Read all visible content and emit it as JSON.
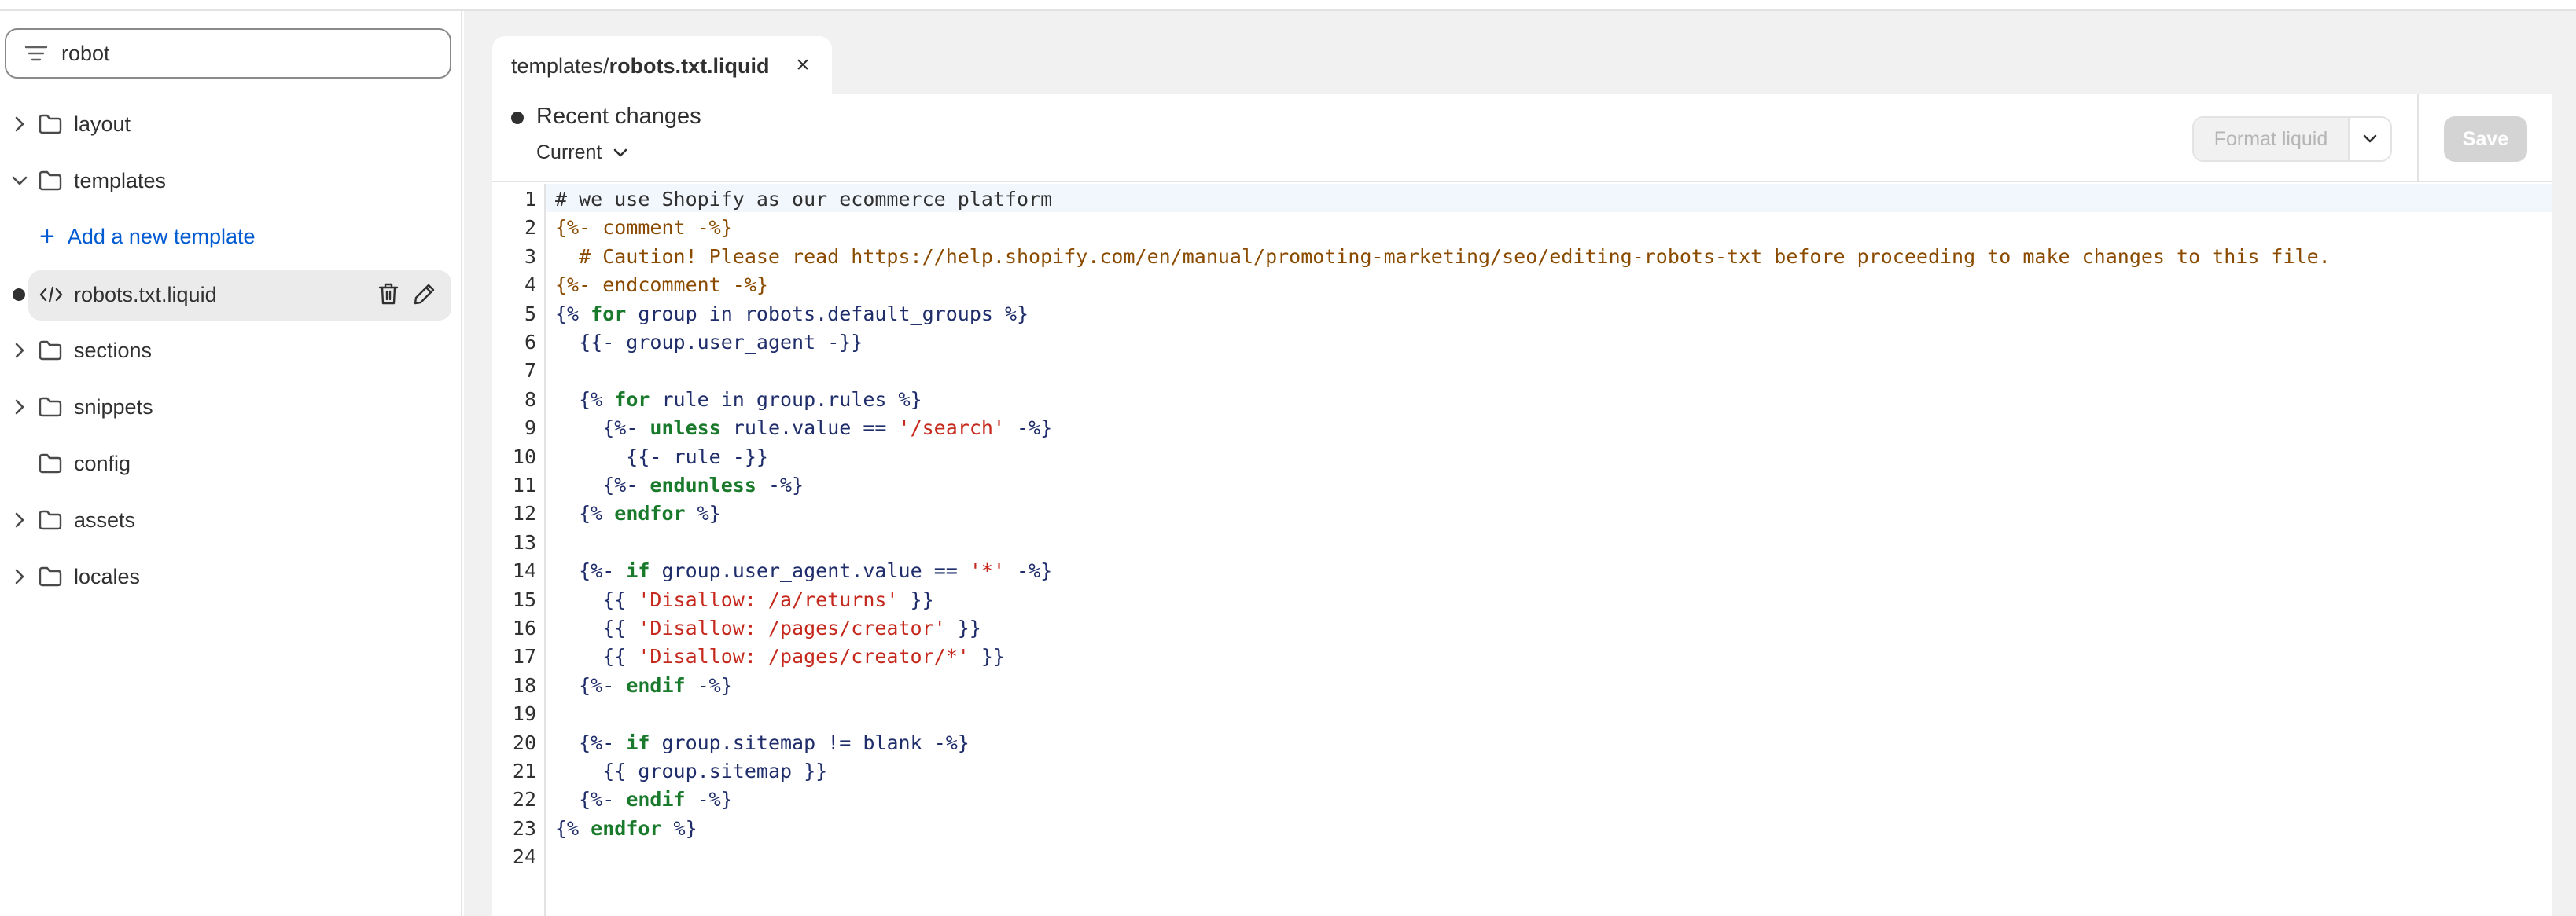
{
  "sidebar": {
    "search_value": "robot",
    "tree": [
      {
        "label": "layout",
        "expanded": false
      },
      {
        "label": "templates",
        "expanded": true
      },
      {
        "label": "sections",
        "expanded": false
      },
      {
        "label": "snippets",
        "expanded": false
      },
      {
        "label": "config",
        "expanded": false
      },
      {
        "label": "assets",
        "expanded": false
      },
      {
        "label": "locales",
        "expanded": false
      }
    ],
    "add_template_label": "Add a new template",
    "selected_file": "robots.txt.liquid"
  },
  "tab": {
    "path": "templates/",
    "filename": "robots.txt.liquid",
    "close": "×"
  },
  "toolbar": {
    "recent_changes": "Recent changes",
    "version_select": "Current",
    "format_label": "Format liquid",
    "save_label": "Save"
  },
  "editor": {
    "line_numbers": [
      "1",
      "2",
      "3",
      "4",
      "5",
      "6",
      "7",
      "8",
      "9",
      "10",
      "11",
      "12",
      "13",
      "14",
      "15",
      "16",
      "17",
      "18",
      "19",
      "20",
      "21",
      "22",
      "23",
      "24"
    ],
    "lines": [
      [
        {
          "t": "# we use Shopify as our ecommerce platform",
          "c": ""
        }
      ],
      [
        {
          "t": "{%- comment -%}",
          "c": "com"
        }
      ],
      [
        {
          "t": "  # Caution! Please read https://help.shopify.com/en/manual/promoting-marketing/seo/editing-robots-txt before proceeding to make changes to this file.",
          "c": "com"
        }
      ],
      [
        {
          "t": "{%- endcomment -%}",
          "c": "com"
        }
      ],
      [
        {
          "t": "{% ",
          "c": "tag"
        },
        {
          "t": "for",
          "c": "kw"
        },
        {
          "t": " group ",
          "c": "id"
        },
        {
          "t": "in",
          "c": "tag"
        },
        {
          "t": " robots",
          "c": "id"
        },
        {
          "t": ".",
          "c": "tag"
        },
        {
          "t": "default_groups",
          "c": "id"
        },
        {
          "t": " %}",
          "c": "tag"
        }
      ],
      [
        {
          "t": "  {{- group",
          "c": "tag"
        },
        {
          "t": ".",
          "c": "tag"
        },
        {
          "t": "user_agent -}}",
          "c": "tag"
        }
      ],
      [
        {
          "t": "",
          "c": ""
        }
      ],
      [
        {
          "t": "  {% ",
          "c": "tag"
        },
        {
          "t": "for",
          "c": "kw"
        },
        {
          "t": " rule ",
          "c": "id"
        },
        {
          "t": "in",
          "c": "tag"
        },
        {
          "t": " group",
          "c": "id"
        },
        {
          "t": ".",
          "c": "tag"
        },
        {
          "t": "rules",
          "c": "id"
        },
        {
          "t": " %}",
          "c": "tag"
        }
      ],
      [
        {
          "t": "    {%- ",
          "c": "tag"
        },
        {
          "t": "unless",
          "c": "kw"
        },
        {
          "t": " rule",
          "c": "id"
        },
        {
          "t": ".",
          "c": "tag"
        },
        {
          "t": "value ",
          "c": "id"
        },
        {
          "t": "== ",
          "c": "tag"
        },
        {
          "t": "'/search'",
          "c": "str"
        },
        {
          "t": " -%}",
          "c": "tag"
        }
      ],
      [
        {
          "t": "      {{- rule -}}",
          "c": "tag"
        }
      ],
      [
        {
          "t": "    {%- ",
          "c": "tag"
        },
        {
          "t": "endunless",
          "c": "kw"
        },
        {
          "t": " -%}",
          "c": "tag"
        }
      ],
      [
        {
          "t": "  {% ",
          "c": "tag"
        },
        {
          "t": "endfor",
          "c": "kw"
        },
        {
          "t": " %}",
          "c": "tag"
        }
      ],
      [
        {
          "t": "",
          "c": ""
        }
      ],
      [
        {
          "t": "  {%- ",
          "c": "tag"
        },
        {
          "t": "if",
          "c": "kw"
        },
        {
          "t": " group",
          "c": "id"
        },
        {
          "t": ".",
          "c": "tag"
        },
        {
          "t": "user_agent",
          "c": "id"
        },
        {
          "t": ".",
          "c": "tag"
        },
        {
          "t": "value ",
          "c": "id"
        },
        {
          "t": "== ",
          "c": "tag"
        },
        {
          "t": "'*'",
          "c": "str"
        },
        {
          "t": " -%}",
          "c": "tag"
        }
      ],
      [
        {
          "t": "    {{ ",
          "c": "tag"
        },
        {
          "t": "'Disallow: /a/returns'",
          "c": "str"
        },
        {
          "t": " }}",
          "c": "tag"
        }
      ],
      [
        {
          "t": "    {{ ",
          "c": "tag"
        },
        {
          "t": "'Disallow: /pages/creator'",
          "c": "str"
        },
        {
          "t": " }}",
          "c": "tag"
        }
      ],
      [
        {
          "t": "    {{ ",
          "c": "tag"
        },
        {
          "t": "'Disallow: /pages/creator/*'",
          "c": "str"
        },
        {
          "t": " }}",
          "c": "tag"
        }
      ],
      [
        {
          "t": "  {%- ",
          "c": "tag"
        },
        {
          "t": "endif",
          "c": "kw"
        },
        {
          "t": " -%}",
          "c": "tag"
        }
      ],
      [
        {
          "t": "",
          "c": ""
        }
      ],
      [
        {
          "t": "  {%- ",
          "c": "tag"
        },
        {
          "t": "if",
          "c": "kw"
        },
        {
          "t": " group",
          "c": "id"
        },
        {
          "t": ".",
          "c": "tag"
        },
        {
          "t": "sitemap ",
          "c": "id"
        },
        {
          "t": "!= ",
          "c": "tag"
        },
        {
          "t": "blank",
          "c": "id"
        },
        {
          "t": " -%}",
          "c": "tag"
        }
      ],
      [
        {
          "t": "    {{ group",
          "c": "tag"
        },
        {
          "t": ".",
          "c": "tag"
        },
        {
          "t": "sitemap }}",
          "c": "tag"
        }
      ],
      [
        {
          "t": "  {%- ",
          "c": "tag"
        },
        {
          "t": "endif",
          "c": "kw"
        },
        {
          "t": " -%}",
          "c": "tag"
        }
      ],
      [
        {
          "t": "{% ",
          "c": "tag"
        },
        {
          "t": "endfor",
          "c": "kw"
        },
        {
          "t": " %}",
          "c": "tag"
        }
      ],
      [
        {
          "t": "",
          "c": ""
        }
      ]
    ]
  },
  "colors": {
    "accent": "#005bd3",
    "comment": "#8a4b00",
    "keyword": "#1a7a2c",
    "string": "#c5281c",
    "tag": "#1f2d6b"
  }
}
